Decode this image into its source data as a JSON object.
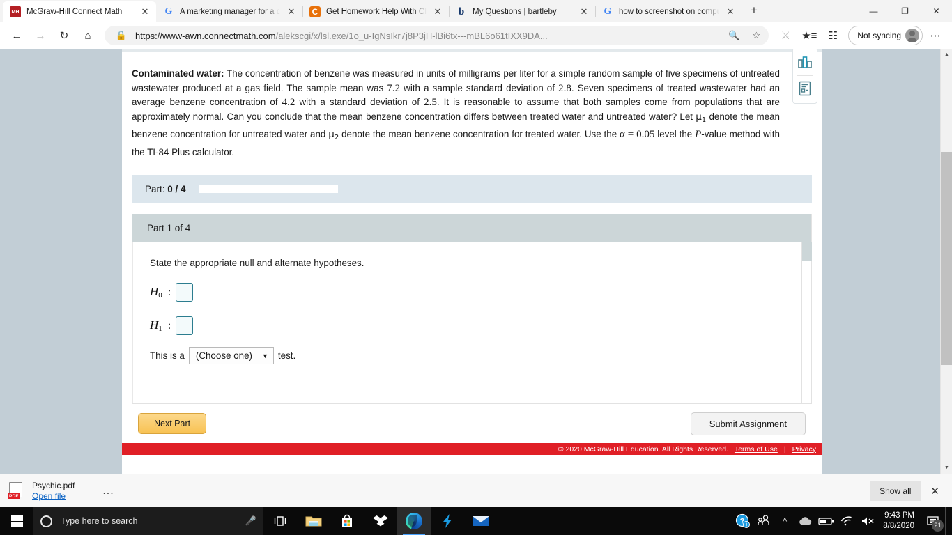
{
  "browser": {
    "tabs": [
      {
        "title": "McGraw-Hill Connect Math",
        "favicon": "mcgraw-hill-icon",
        "active": true
      },
      {
        "title": "A marketing manager for a cel",
        "favicon": "google-icon",
        "active": false
      },
      {
        "title": "Get Homework Help With Che",
        "favicon": "chegg-icon",
        "active": false
      },
      {
        "title": "My Questions | bartleby",
        "favicon": "bartleby-icon",
        "active": false
      },
      {
        "title": "how to screenshot on compute",
        "favicon": "google-icon",
        "active": false
      }
    ],
    "new_tab_label": "+",
    "close_label": "✕",
    "window_controls": {
      "minimize": "—",
      "restore": "❐",
      "close": "✕"
    },
    "nav": {
      "back": "←",
      "forward": "→",
      "refresh": "↻",
      "home": "⌂"
    },
    "omnibox": {
      "lock_icon": "lock-icon",
      "url_prefix": "https://www-awn.connectmath.com",
      "url_path": "/alekscgi/x/lsl.exe/1o_u-IgNsIkr7j8P3jH-lBi6tx---mBL6o61tIXX9DA...",
      "zoom_icon": "zoom-in-icon",
      "favorite_icon": "star-icon"
    },
    "extension_icon": "extension-icon",
    "favorites_icon": "favorites-list-icon",
    "collections_icon": "collections-icon",
    "profile": {
      "label": "Not syncing",
      "avatar": "avatar-icon"
    },
    "settings_icon": "ellipsis-icon"
  },
  "question": {
    "title": "Contaminated water:",
    "body_part1": " The concentration of benzene was measured in units of milligrams per liter for a simple random sample of five specimens of untreated wastewater produced at a gas field. The sample mean was ",
    "sample_mean": "7.2",
    "body_part2": " with a sample standard deviation of ",
    "sample_sd": "2.8",
    "body_part3": ". Seven specimens of treated wastewater had an average benzene concentration of ",
    "treated_mean": "4.2",
    "body_part4": " with a standard deviation of ",
    "treated_sd": "2.5",
    "body_part5": ". It is reasonable to assume that both samples come from populations that are approximately normal. Can you conclude that the mean benzene concentration differs between treated water and untreated water? Let ",
    "mu1": "μ",
    "mu1_sub": "1",
    "body_part6": " denote the mean benzene concentration for untreated water and ",
    "mu2": "μ",
    "mu2_sub": "2",
    "body_part7": " denote the mean benzene concentration for treated water. Use the ",
    "alpha": "α = 0.05",
    "body_part8": " level the ",
    "pvalue": "P",
    "body_part9": "-value method with the TI-84 Plus calculator."
  },
  "tools": {
    "chart_icon": "bar-chart-icon",
    "table_icon": "data-table-icon"
  },
  "part_bar": {
    "label": "Part:",
    "count": "0 / 4",
    "progress_percent": 0
  },
  "part_panel": {
    "header": "Part 1 of 4",
    "prompt": "State the appropriate null and alternate hypotheses.",
    "hypotheses": [
      {
        "symbol": "H",
        "subscript": "0",
        "colon": ":",
        "value": ""
      },
      {
        "symbol": "H",
        "subscript": "1",
        "colon": ":",
        "value": ""
      }
    ],
    "test_prefix": "This is a",
    "test_select_value": "(Choose one)",
    "test_select_caret": "▼",
    "test_suffix": "test."
  },
  "actions": {
    "next_part": "Next Part",
    "submit_assignment": "Submit Assignment"
  },
  "footer": {
    "copyright": "© 2020 McGraw-Hill Education. All Rights Reserved.",
    "terms": "Terms of Use",
    "separator": "|",
    "privacy": "Privacy"
  },
  "download_shelf": {
    "file_name": "Psychic.pdf",
    "open_link": "Open file",
    "file_type_badge": "PDF",
    "more_label": "...",
    "show_all": "Show all",
    "close": "✕"
  },
  "taskbar": {
    "start_icon": "windows-start-icon",
    "search_placeholder": "Type here to search",
    "mic_icon": "microphone-icon",
    "apps": [
      {
        "name": "task-view-icon"
      },
      {
        "name": "file-explorer-icon"
      },
      {
        "name": "microsoft-store-icon"
      },
      {
        "name": "dropbox-icon"
      },
      {
        "name": "microsoft-edge-icon",
        "active": true
      },
      {
        "name": "snagit-icon"
      },
      {
        "name": "mail-icon"
      }
    ],
    "tray": {
      "help_icon": "help-question-icon",
      "people_icon": "people-icon",
      "overflow_icon": "show-hidden-icons-icon",
      "onedrive_icon": "onedrive-icon",
      "battery_icon": "battery-icon",
      "wifi_icon": "wifi-icon",
      "volume_icon": "volume-muted-icon",
      "time": "9:43 PM",
      "date": "8/8/2020",
      "notification_icon": "action-center-icon",
      "notification_count": "21"
    }
  },
  "colors": {
    "brand_red": "#e01f26",
    "page_bg": "#c2ced6",
    "part_bar_bg": "#dce6ed",
    "part_head_bg": "#ccd6d8",
    "accent_input": "#2c7d8f",
    "next_button": "#f8c253"
  }
}
